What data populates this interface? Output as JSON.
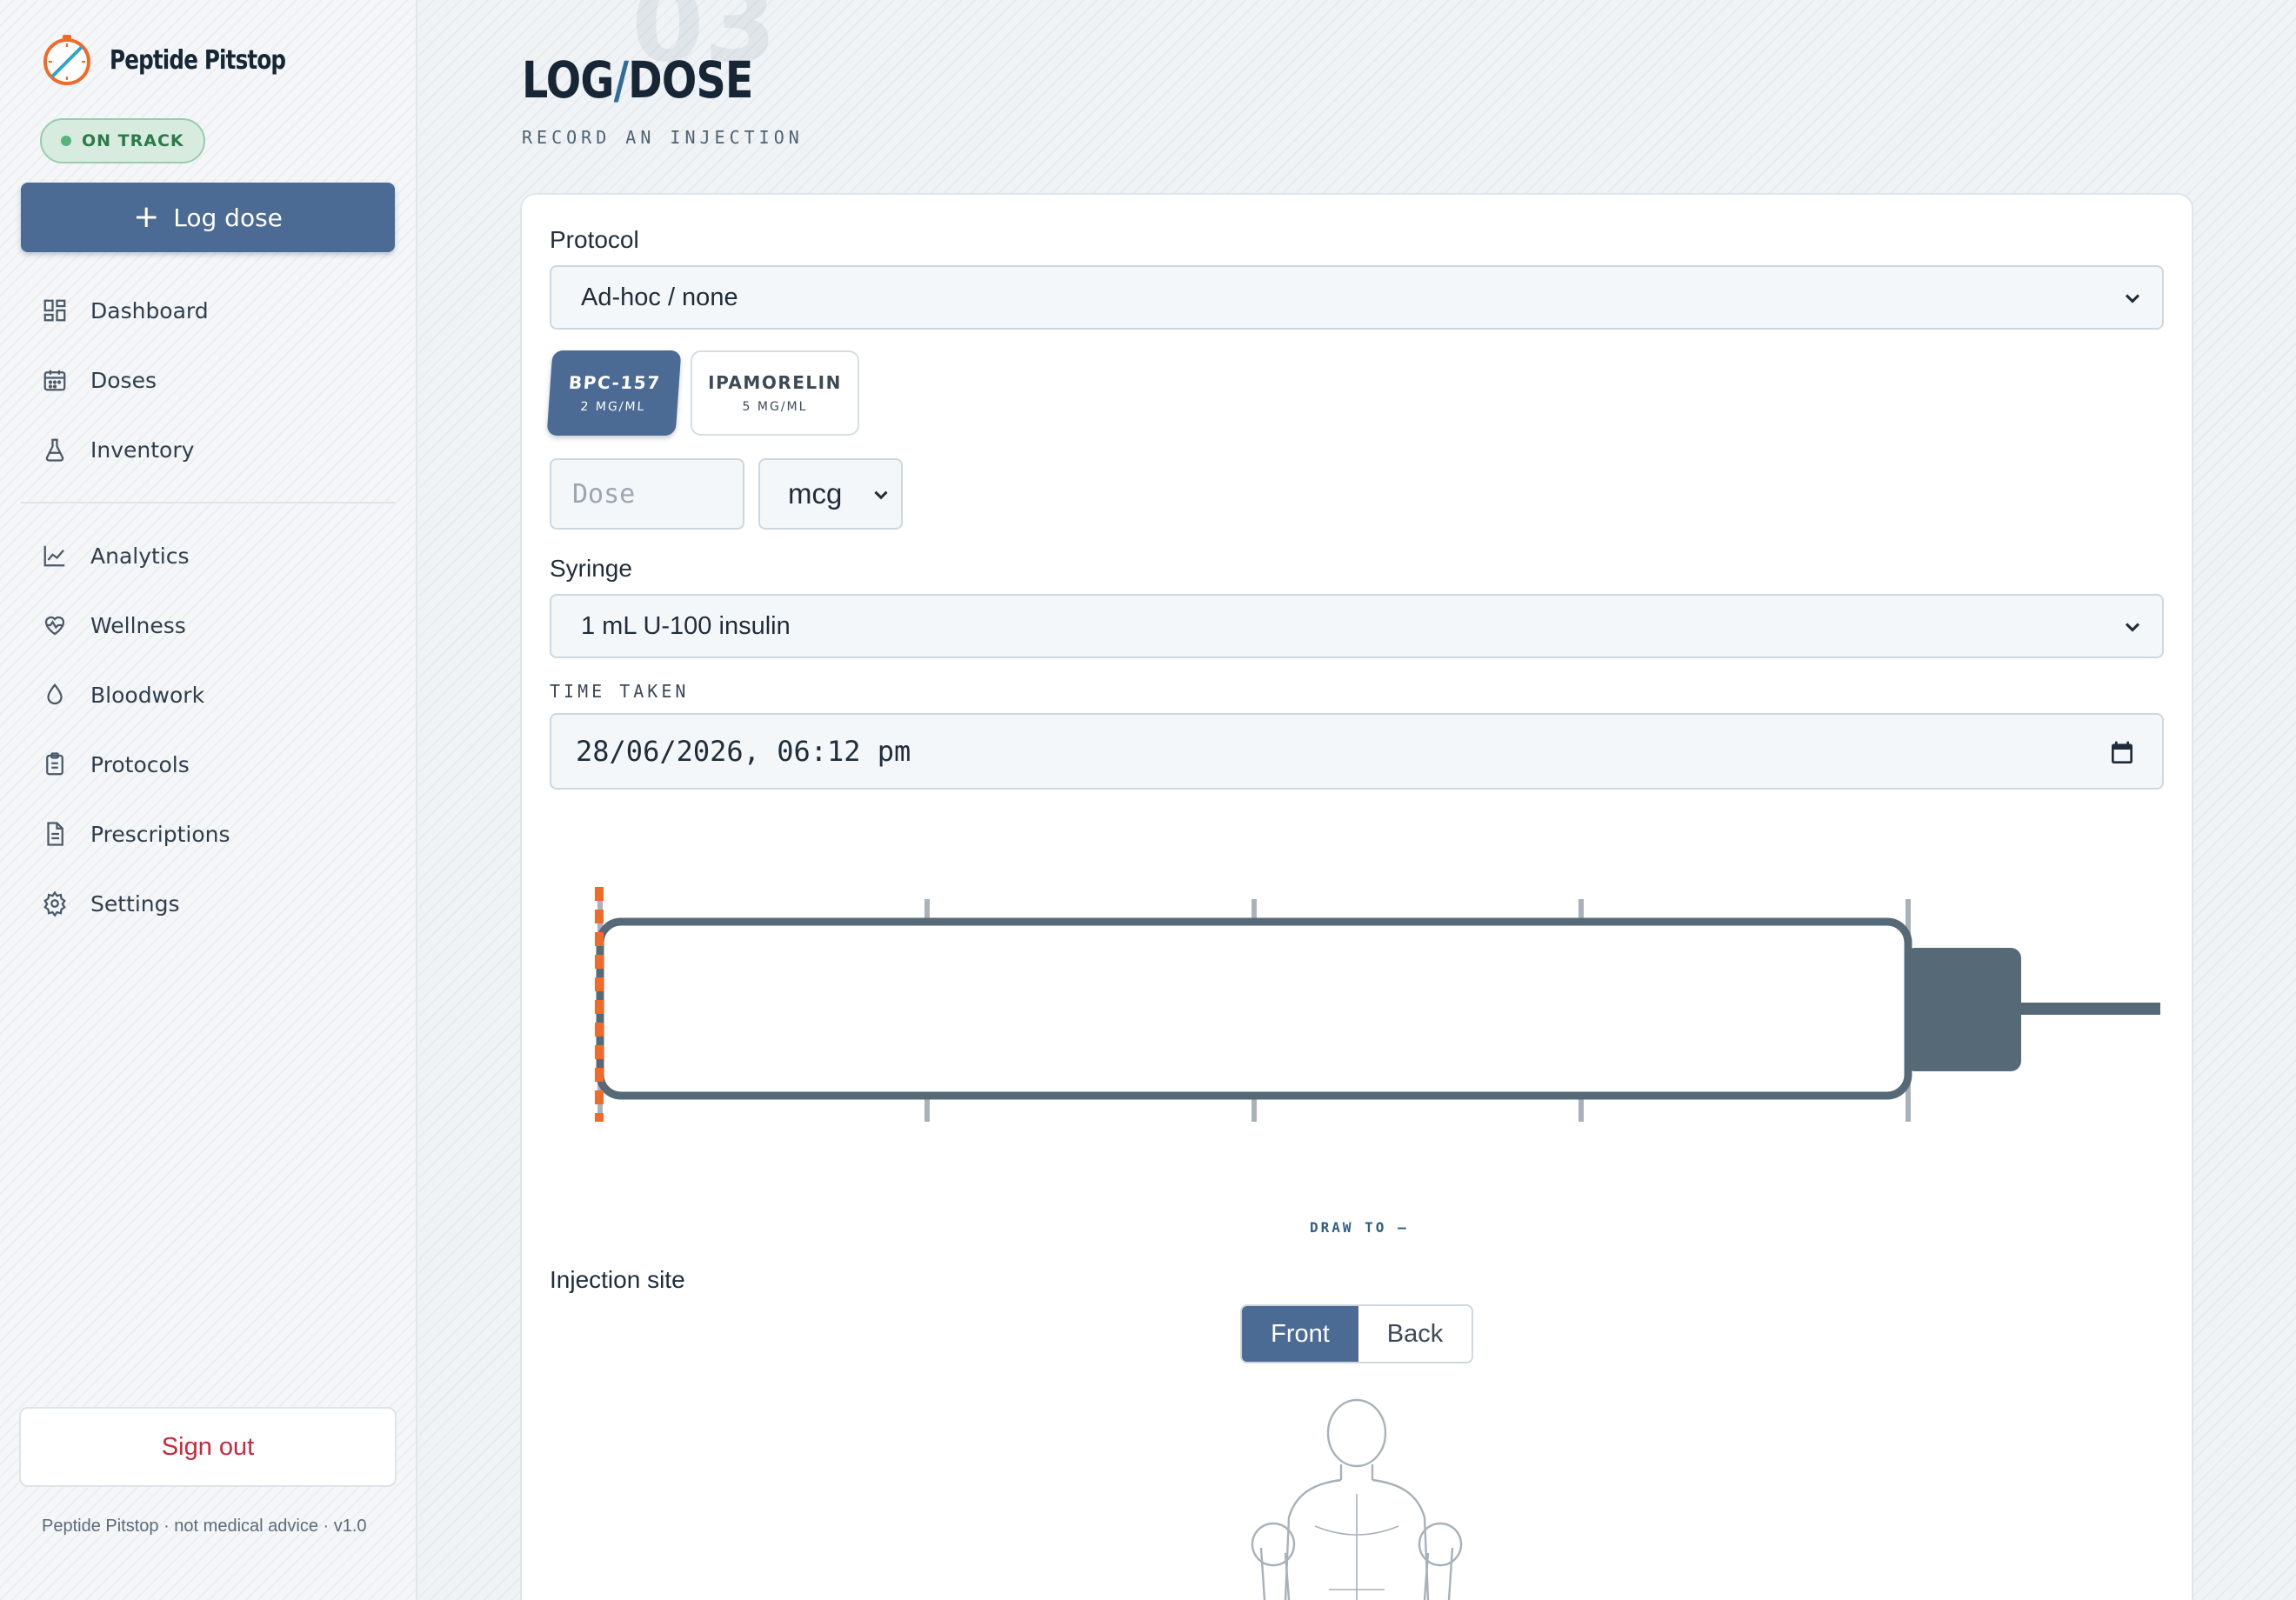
{
  "app": {
    "name": "Peptide Pitstop",
    "status_label": "ON TRACK",
    "log_button_label": "Log dose",
    "accent_color": "#4b6a94",
    "brand_orange": "#f06a2a"
  },
  "sidebar": {
    "items_primary": [
      {
        "label": "Dashboard",
        "icon": "dashboard-icon"
      },
      {
        "label": "Doses",
        "icon": "calendar-icon"
      },
      {
        "label": "Inventory",
        "icon": "flask-icon"
      }
    ],
    "items_secondary": [
      {
        "label": "Analytics",
        "icon": "chart-line-icon"
      },
      {
        "label": "Wellness",
        "icon": "heart-pulse-icon"
      },
      {
        "label": "Bloodwork",
        "icon": "droplet-icon"
      },
      {
        "label": "Protocols",
        "icon": "clipboard-icon"
      },
      {
        "label": "Prescriptions",
        "icon": "document-icon"
      },
      {
        "label": "Settings",
        "icon": "gear-icon"
      }
    ],
    "sign_out_label": "Sign out",
    "footer_text": "Peptide Pitstop · not medical advice · v1.0"
  },
  "page": {
    "ghost_number": "03",
    "title_left": "LOG",
    "title_slash": "/",
    "title_right": "DOSE",
    "subtitle": "RECORD AN INJECTION"
  },
  "form": {
    "protocol_label": "Protocol",
    "protocol_value": "Ad-hoc / none",
    "peptides": [
      {
        "name": "BPC-157",
        "concentration": "2 MG/ML",
        "selected": true
      },
      {
        "name": "IPAMORELIN",
        "concentration": "5 MG/ML",
        "selected": false
      }
    ],
    "dose_placeholder": "Dose",
    "dose_unit": "mcg",
    "syringe_label": "Syringe",
    "syringe_value": "1 mL U-100 insulin",
    "time_label": "TIME TAKEN",
    "time_value": "28/06/2026, 06:12 pm",
    "draw_to_label": "DRAW TO —",
    "injection_site_label": "Injection site",
    "view_options": [
      "Front",
      "Back"
    ],
    "view_selected": "Front"
  },
  "syringe_gauge": {
    "fill_fraction": 0,
    "tick_count": 5,
    "barrel_color": "#566977",
    "marker_color": "#f06a2a"
  }
}
